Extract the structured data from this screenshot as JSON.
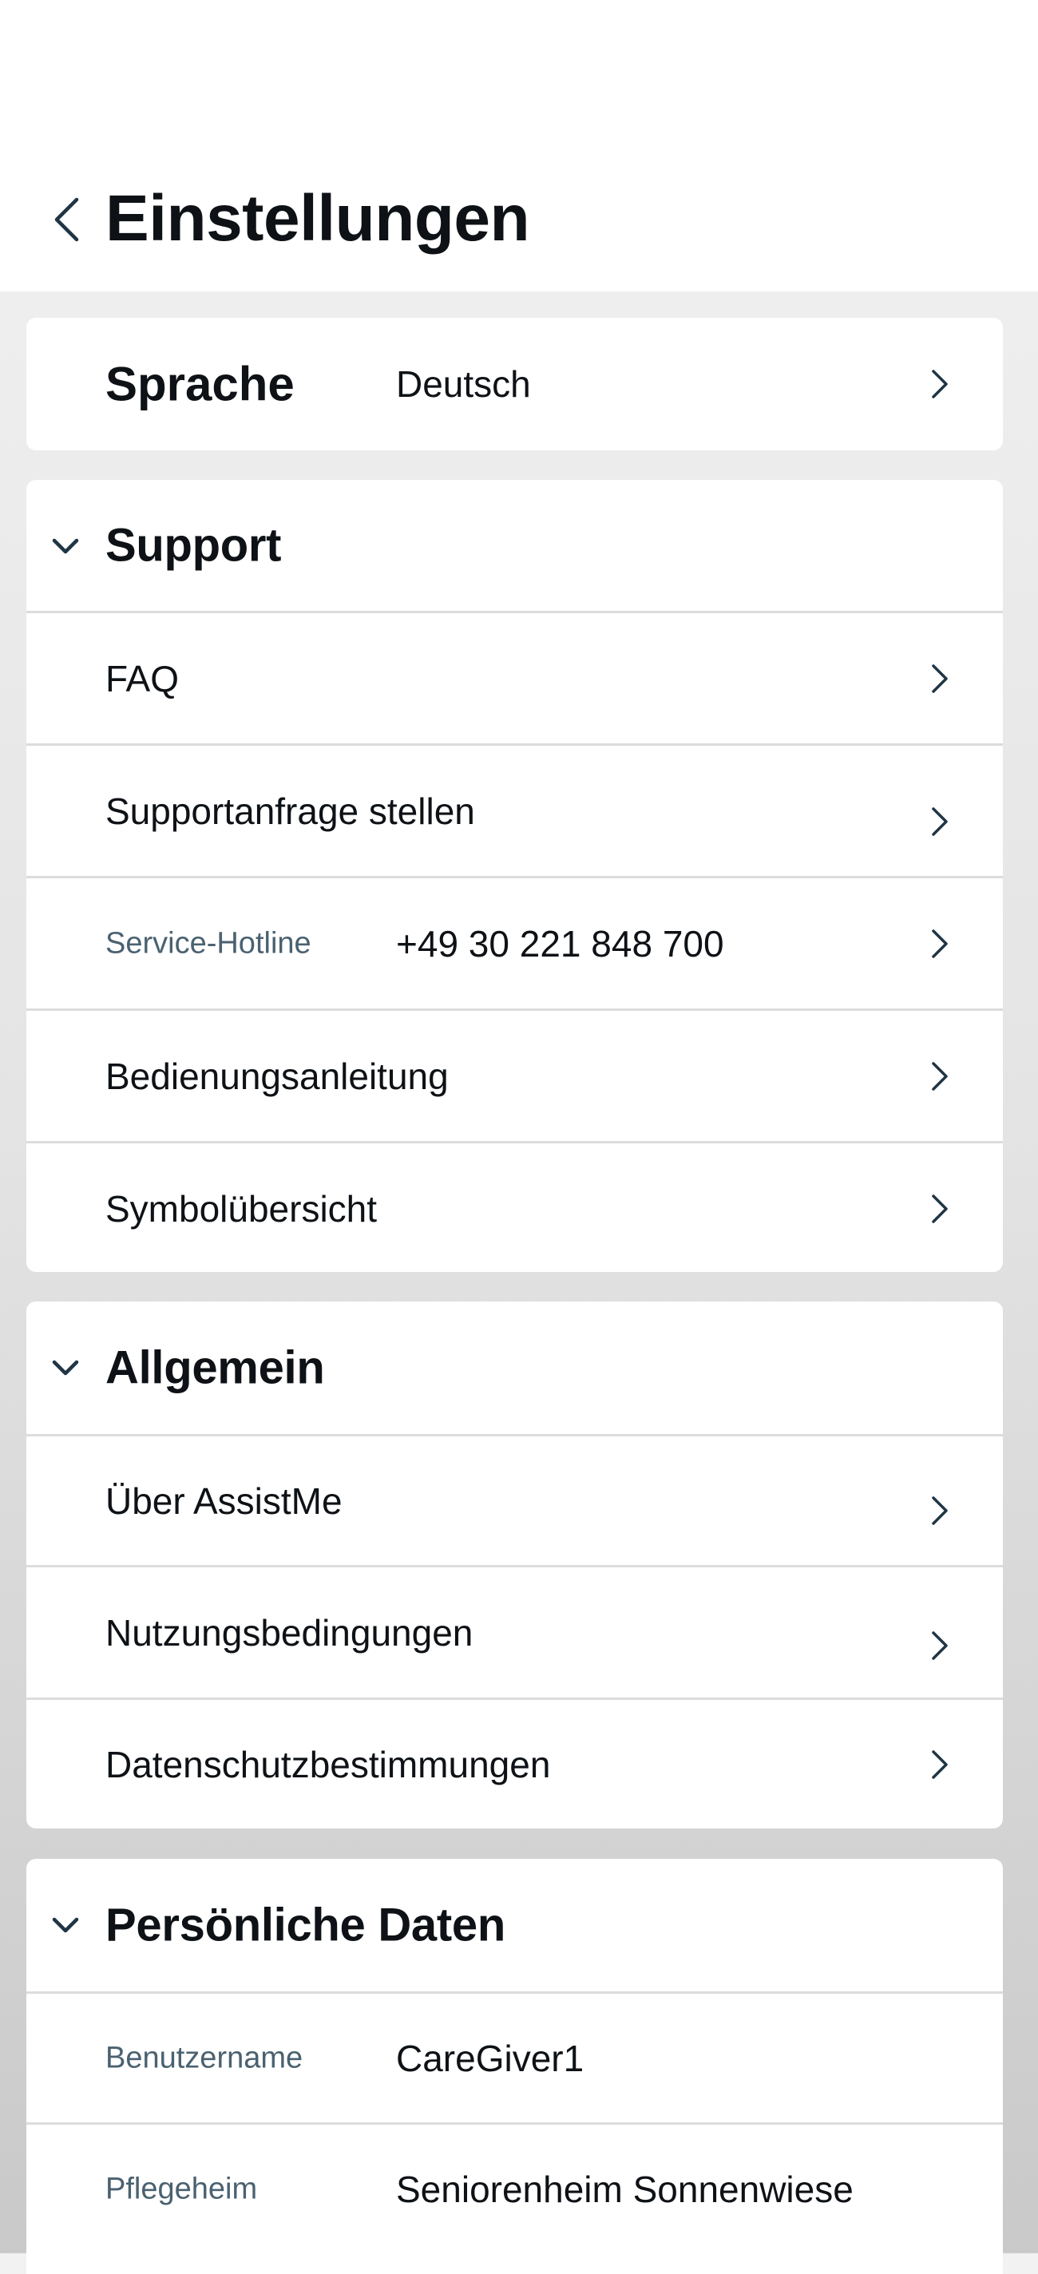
{
  "header": {
    "title": "Einstellungen"
  },
  "language": {
    "label": "Sprache",
    "value": "Deutsch"
  },
  "support": {
    "title": "Support",
    "items": {
      "faq": {
        "label": "FAQ"
      },
      "request": {
        "label": "Supportanfrage stellen"
      },
      "hotline": {
        "label": "Service-Hotline",
        "value": "+49 30 221 848 700"
      },
      "manual": {
        "label": "Bedienungsanleitung"
      },
      "symbols": {
        "label": "Symbolübersicht"
      }
    }
  },
  "general": {
    "title": "Allgemein",
    "items": {
      "about": {
        "label": "Über AssistMe"
      },
      "terms": {
        "label": "Nutzungsbedingungen"
      },
      "privacy": {
        "label": "Datenschutzbestimmungen"
      }
    }
  },
  "personal": {
    "title": "Persönliche Daten",
    "items": {
      "username": {
        "label": "Benutzername",
        "value": "CareGiver1"
      },
      "home": {
        "label": "Pflegeheim",
        "value": "Seniorenheim Sonnenwiese"
      }
    }
  },
  "colors": {
    "accent": "#1f3545",
    "muted_label": "#4a6170",
    "divider": "#dcdcdc",
    "text": "#0e1216"
  },
  "icons": {
    "back": "chevron-left-icon",
    "row_nav": "chevron-right-icon",
    "section_toggle": "chevron-down-icon"
  }
}
